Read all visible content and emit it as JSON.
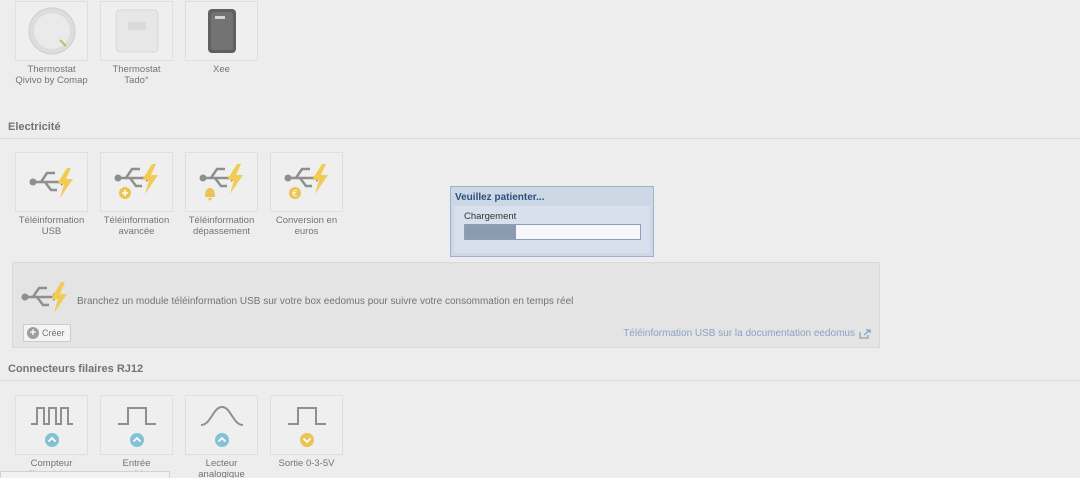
{
  "thermostats": {
    "items": [
      {
        "label": "Thermostat Qivivo by Comap"
      },
      {
        "label": "Thermostat Tado°"
      },
      {
        "label": "Xee"
      }
    ]
  },
  "electricity": {
    "title": "Electricité",
    "items": [
      {
        "label": "Téléinformation USB"
      },
      {
        "label": "Téléinformation avancée"
      },
      {
        "label": "Téléinformation dépassement"
      },
      {
        "label": "Conversion en euros"
      }
    ],
    "detail": {
      "description": "Branchez un module téléinformation USB sur votre box eedomus pour suivre votre consommation en temps réel",
      "create_label": "Créer",
      "doc_link": "Téléinformation USB sur la documentation eedomus"
    }
  },
  "connectors": {
    "title": "Connecteurs filaires RJ12",
    "items": [
      {
        "label": "Compteur d'impulsions"
      },
      {
        "label": "Entrée numérique"
      },
      {
        "label": "Lecteur analogique"
      },
      {
        "label": "Sortie 0-3-5V"
      }
    ]
  },
  "loading_dialog": {
    "title": "Veuillez patienter...",
    "message": "Chargement",
    "progress": 0.29
  },
  "colors": {
    "accent_yellow": "#e8b830",
    "accent_blue": "#6ab4cc",
    "link_blue": "#6f8fb8"
  }
}
